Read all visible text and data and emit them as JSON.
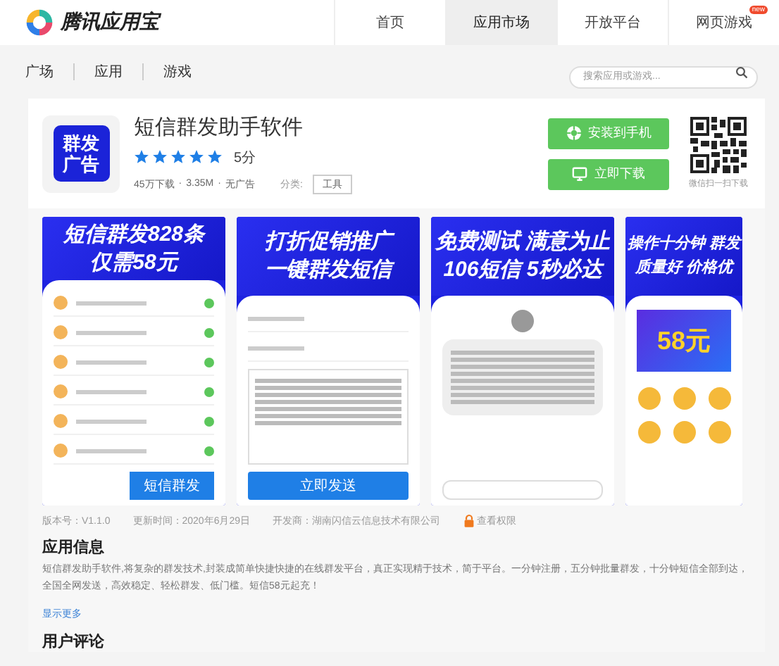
{
  "header": {
    "logo_text": "腾讯应用宝",
    "nav": [
      {
        "label": "首页",
        "selected": false
      },
      {
        "label": "应用市场",
        "selected": true
      },
      {
        "label": "开放平台",
        "selected": false
      },
      {
        "label": "网页游戏",
        "selected": false,
        "badge": "new"
      }
    ]
  },
  "subnav": {
    "items": [
      {
        "label": "广场"
      },
      {
        "label": "应用"
      },
      {
        "label": "游戏"
      }
    ],
    "search": {
      "placeholder": "搜索应用或游戏..."
    }
  },
  "app": {
    "separator": "·",
    "icon_text": [
      "群发",
      "广告"
    ],
    "title": "短信群发助手软件",
    "stars": 5,
    "score": "5分",
    "downloads": "45万下载",
    "size": "3.35M",
    "ads": "无广告",
    "category_label": "分类:",
    "category": "工具",
    "install_button": "安装到手机",
    "download_button": "立即下载",
    "qr_caption": "微信扫一扫下载"
  },
  "screenshots": [
    {
      "kind": "contacts",
      "headline": [
        "短信群发828条",
        "仅需58元"
      ],
      "button": "短信群发"
    },
    {
      "kind": "compose",
      "headline": [
        "打折促销推广",
        "一键群发短信"
      ],
      "button": "立即发送"
    },
    {
      "kind": "message",
      "headline": [
        "免费测试 满意为止",
        "106短信 5秒必达"
      ]
    },
    {
      "kind": "dashboard",
      "headline": [
        "操作十分钟 群发",
        "质量好 价格优"
      ],
      "promo": "58元"
    }
  ],
  "meta": {
    "version": "版本号：V1.1.0",
    "updated": "更新时间：2020年6月29日",
    "developer": "开发商：湖南闪信云信息技术有限公司",
    "permissions": "查看权限"
  },
  "info": {
    "heading": "应用信息",
    "description": "短信群发助手软件,将复杂的群发技术,封装成简单快捷快捷的在线群发平台，真正实现精于技术，简于平台。一分钟注册，五分钟批量群发，十分钟短信全部到达，全国全网发送，高效稳定、轻松群发、低门槛。短信58元起充！",
    "more": "显示更多"
  },
  "reviews": {
    "heading": "用户评论"
  }
}
